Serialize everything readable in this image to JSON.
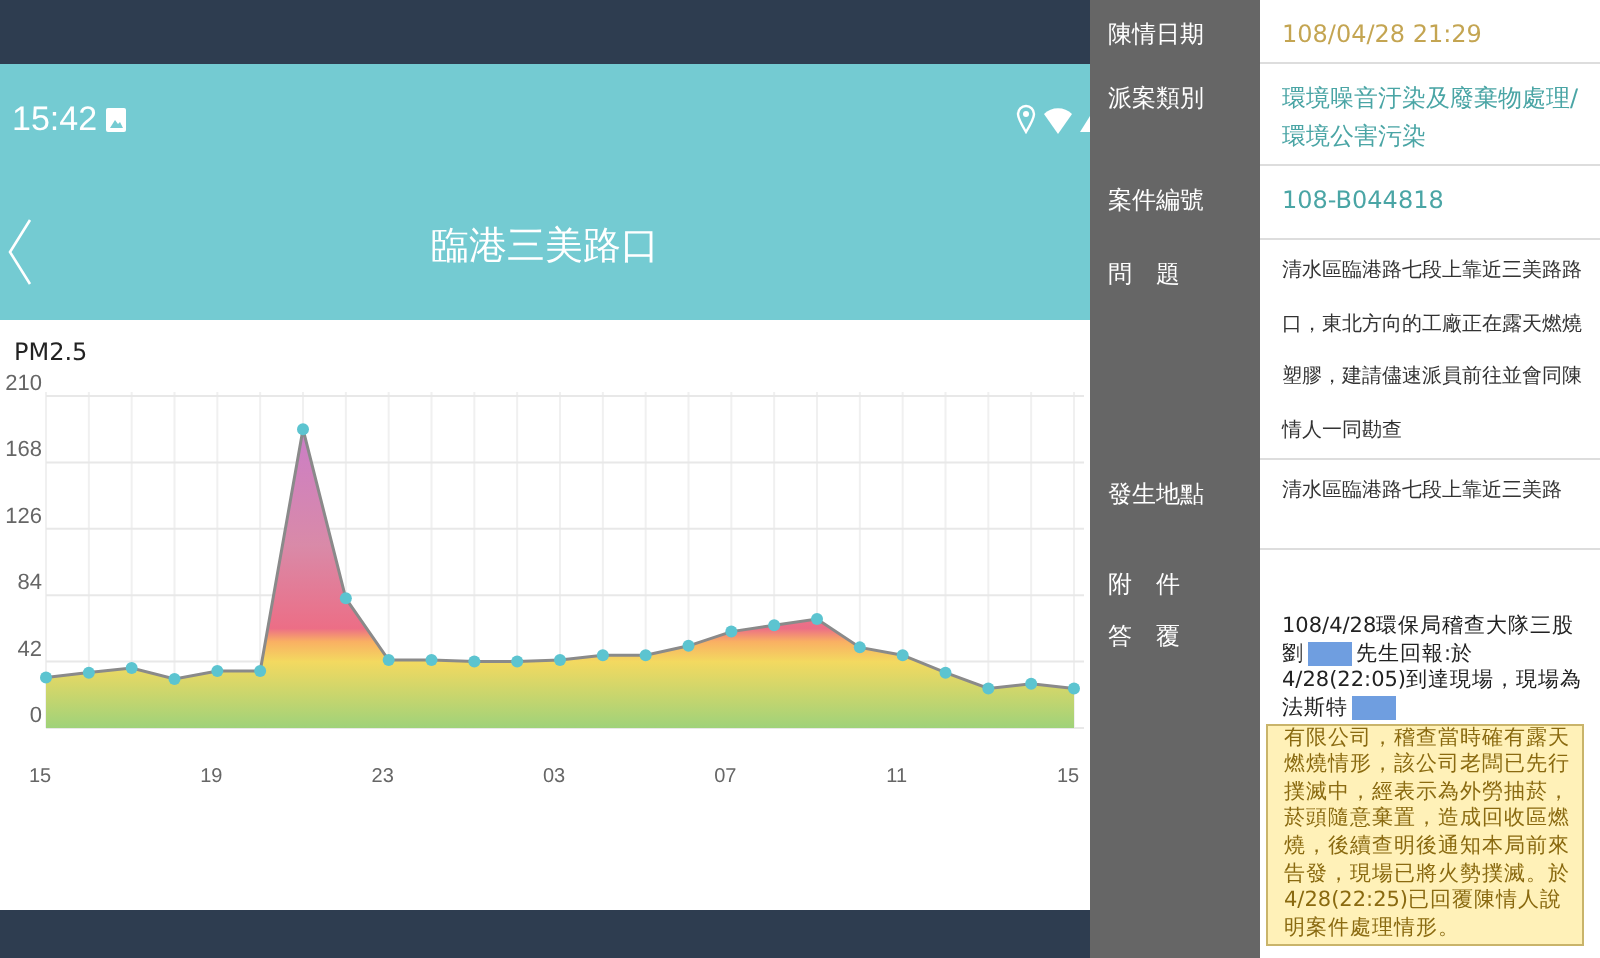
{
  "phone": {
    "status_bar": {
      "time": "15:42"
    },
    "title": "臨港三美路口",
    "chart": {
      "chart_data": {
        "type": "area",
        "title": "PM2.5",
        "categories": [
          "15",
          null,
          null,
          null,
          "19",
          null,
          null,
          null,
          "23",
          null,
          null,
          null,
          "03",
          null,
          null,
          null,
          "07",
          null,
          null,
          null,
          "11",
          null,
          null,
          null,
          "15"
        ],
        "grid": true,
        "series": [
          {
            "color": "#8a8a8a",
            "values": [
              32,
              35,
              38,
              31,
              36,
              36,
              189,
              82,
              43,
              43,
              42,
              42,
              43,
              46,
              46,
              52,
              61,
              65,
              69,
              51,
              46,
              35,
              25,
              28,
              25
            ]
          }
        ],
        "ylim": [
          0,
          210
        ],
        "yticks": [
          0,
          42,
          84,
          126,
          168,
          210
        ]
      }
    }
  },
  "details": [
    {
      "label": "陳情日期",
      "kind": "date",
      "value": "108/04/28 21:29"
    },
    {
      "label": "派案類別",
      "kind": "link",
      "value": "環境噪音汙染及廢棄物處理/環境公害污染"
    },
    {
      "label": "案件編號",
      "kind": "link",
      "value": "108-B044818"
    },
    {
      "label": "問　題",
      "kind": "small",
      "value": "清水區臨港路七段上靠近三美路路口，東北方向的工廠正在露天燃燒塑膠，建請儘速派員前往並會同陳情人一同勘查"
    },
    {
      "label": "發生地點",
      "kind": "small",
      "value": "清水區臨港路七段上靠近三美路"
    },
    {
      "label": "附　件",
      "kind": "empty"
    },
    {
      "label": "答　覆",
      "kind": "answer",
      "segments": [
        {
          "kind": "text",
          "text": "108/4/28環保局稽查大隊三股劉"
        },
        {
          "kind": "redaction"
        },
        {
          "kind": "text",
          "text": "先生回報:於4/28(22:05)到達現場，現場為法斯特"
        },
        {
          "kind": "redaction"
        },
        {
          "kind": "highlight",
          "text": "有限公司，稽查當時確有露天燃燒情形，該公司老闆已先行撲滅中，經表示為外勞抽菸，菸頭隨意棄置，造成回收區燃燒，後續查明後通知本局前來告發，現場已將火勢撲滅。於4/28(22:25)已回覆陳情人說明案件處理情形。"
        }
      ]
    }
  ]
}
